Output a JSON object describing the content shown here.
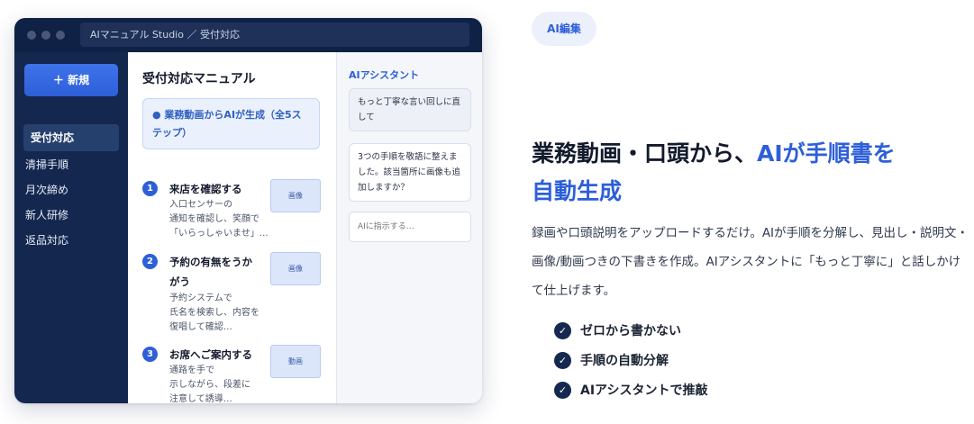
{
  "window": {
    "address": "AIマニュアル Studio ／ 受付対応"
  },
  "sidebar": {
    "new_button": "＋ 新規",
    "items": [
      {
        "label": "受付対応"
      },
      {
        "label": "清掃手順"
      },
      {
        "label": "月次締め"
      },
      {
        "label": "新人研修"
      },
      {
        "label": "返品対応"
      }
    ]
  },
  "document": {
    "title": "受付対応マニュアル",
    "banner": "● 業務動画からAIが生成（全5ステップ）",
    "steps": [
      {
        "num": "1",
        "title": "来店を確認する",
        "desc": [
          "入口センサーの",
          "通知を確認し、笑顔で",
          "「いらっしゃいませ」…"
        ],
        "thumb": "画像"
      },
      {
        "num": "2",
        "title": "予約の有無をうかがう",
        "desc": [
          "予約システムで",
          "氏名を検索し、内容を",
          "復唱して確認…"
        ],
        "thumb": "画像"
      },
      {
        "num": "3",
        "title": "お席へご案内する",
        "desc": [
          "通路を手で",
          "示しながら、段差に",
          "注意して誘導…"
        ],
        "thumb": "動画"
      }
    ]
  },
  "assistant": {
    "title": "AIアシスタント",
    "messages": [
      "もっと丁寧な言い回しに直して",
      "3つの手順を敬語に整えました。該当箇所に画像も追加しますか？"
    ],
    "input_placeholder": "AIに指示する…"
  },
  "marketing": {
    "tag": "AI編集",
    "headline_part1": "業務動画・口頭から、",
    "headline_accent1": "AIが手順書を",
    "headline_accent2": "自動生成",
    "body": "録画や口頭説明をアップロードするだけ。AIが手順を分解し、見出し・説明文・画像/動画つきの下書きを作成。AIアシスタントに「もっと丁寧に」と話しかけて仕上げます。",
    "features": [
      {
        "label": "ゼロから書かない"
      },
      {
        "label": "手順の自動分解"
      },
      {
        "label": "AIアシスタントで推敲"
      }
    ]
  },
  "colors": {
    "accent": "#2d5fd8",
    "navy": "#14274f",
    "titlebar": "#0f2144"
  }
}
